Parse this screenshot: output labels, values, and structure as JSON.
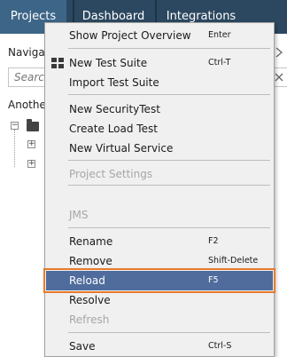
{
  "tabs": [
    {
      "label": "Projects",
      "active": true
    },
    {
      "label": "Dashboard",
      "active": false
    },
    {
      "label": "Integrations",
      "active": false
    }
  ],
  "navigator": {
    "title": "Navigat",
    "search_placeholder": "Search",
    "tree_label": "Anothe"
  },
  "context_menu": {
    "items": [
      {
        "label": "Show Project Overview",
        "shortcut": "Enter",
        "enabled": true,
        "selected": false
      },
      {
        "label": "New Test Suite",
        "shortcut": "Ctrl-T",
        "enabled": true,
        "selected": false,
        "icon": "grid-icon"
      },
      {
        "label": "Import Test Suite",
        "shortcut": "",
        "enabled": true,
        "selected": false
      },
      {
        "label": "New SecurityTest",
        "shortcut": "",
        "enabled": true,
        "selected": false
      },
      {
        "label": "Create Load Test",
        "shortcut": "",
        "enabled": true,
        "selected": false
      },
      {
        "label": "New Virtual Service",
        "shortcut": "",
        "enabled": true,
        "selected": false
      },
      {
        "label": "Project Settings",
        "shortcut": "",
        "enabled": false,
        "selected": false
      },
      {
        "label": "JMS",
        "shortcut": "",
        "enabled": false,
        "selected": false
      },
      {
        "label": "Rename",
        "shortcut": "F2",
        "enabled": true,
        "selected": false
      },
      {
        "label": "Remove",
        "shortcut": "Shift-Delete",
        "enabled": true,
        "selected": false
      },
      {
        "label": "Reload",
        "shortcut": "F5",
        "enabled": true,
        "selected": true
      },
      {
        "label": "Resolve",
        "shortcut": "",
        "enabled": true,
        "selected": false
      },
      {
        "label": "Refresh",
        "shortcut": "",
        "enabled": false,
        "selected": false
      },
      {
        "label": "Save",
        "shortcut": "Ctrl-S",
        "enabled": true,
        "selected": false
      }
    ]
  },
  "colors": {
    "tabbar": "#2c4860",
    "tab_active": "#3d6587",
    "menu_bg": "#f0f0f0",
    "selection": "#4f6c9c",
    "focus_outline": "#e57c2a",
    "disabled_text": "#a6a6a6"
  }
}
